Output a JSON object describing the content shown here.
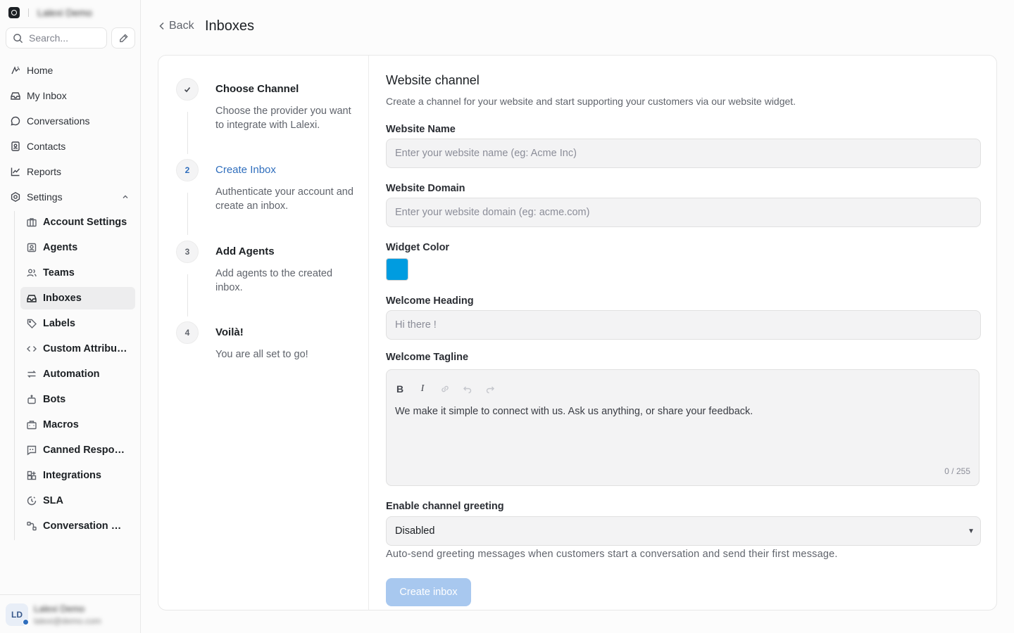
{
  "sidebar": {
    "account_name": "Lalexi Demo",
    "search_placeholder": "Search...",
    "nav": [
      {
        "label": "Home",
        "icon": "home-icon"
      },
      {
        "label": "My Inbox",
        "icon": "inbox-icon"
      },
      {
        "label": "Conversations",
        "icon": "chat-bubble-icon"
      },
      {
        "label": "Contacts",
        "icon": "contact-book-icon"
      },
      {
        "label": "Reports",
        "icon": "line-chart-icon"
      },
      {
        "label": "Settings",
        "icon": "gear-icon"
      }
    ],
    "settings_items": [
      {
        "label": "Account Settings",
        "icon": "briefcase-icon"
      },
      {
        "label": "Agents",
        "icon": "contact-icon"
      },
      {
        "label": "Teams",
        "icon": "users-icon"
      },
      {
        "label": "Inboxes",
        "icon": "inbox-icon",
        "active": true
      },
      {
        "label": "Labels",
        "icon": "tag-icon"
      },
      {
        "label": "Custom Attributes",
        "icon": "code-icon"
      },
      {
        "label": "Automation",
        "icon": "arrows-exchange-icon"
      },
      {
        "label": "Bots",
        "icon": "bot-icon"
      },
      {
        "label": "Macros",
        "icon": "toolbox-icon"
      },
      {
        "label": "Canned Responses",
        "icon": "quote-icon"
      },
      {
        "label": "Integrations",
        "icon": "grid-plus-icon"
      },
      {
        "label": "SLA",
        "icon": "clock-icon"
      },
      {
        "label": "Conversation Workflows",
        "icon": "workflow-icon"
      }
    ],
    "user": {
      "initials": "LD",
      "name": "Lalexi Demo",
      "email": "lalexi@demo.com"
    }
  },
  "header": {
    "back_label": "Back",
    "title": "Inboxes"
  },
  "steps": [
    {
      "marker": "✓",
      "title": "Choose Channel",
      "desc": "Choose the provider you want to integrate with Lalexi."
    },
    {
      "marker": "2",
      "title": "Create Inbox",
      "desc": "Authenticate your account and create an inbox.",
      "active": true
    },
    {
      "marker": "3",
      "title": "Add Agents",
      "desc": "Add agents to the created inbox."
    },
    {
      "marker": "4",
      "title": "Voilà!",
      "desc": "You are all set to go!"
    }
  ],
  "form": {
    "title": "Website channel",
    "subtitle": "Create a channel for your website and start supporting your customers via our website widget.",
    "website_name_label": "Website Name",
    "website_name_placeholder": "Enter your website name (eg: Acme Inc)",
    "website_domain_label": "Website Domain",
    "website_domain_placeholder": "Enter your website domain (eg: acme.com)",
    "widget_color_label": "Widget Color",
    "widget_color": "#009CE0",
    "welcome_heading_label": "Welcome Heading",
    "welcome_heading_placeholder": "Hi there !",
    "welcome_tagline_label": "Welcome Tagline",
    "welcome_tagline_text": "We make it simple to connect with us. Ask us anything, or share your feedback.",
    "tagline_counter": "0 / 255",
    "greeting_label": "Enable channel greeting",
    "greeting_value": "Disabled",
    "greeting_help": "Auto-send greeting messages when customers start a conversation and send their first message.",
    "submit_label": "Create inbox"
  },
  "colors": {
    "accent": "#2F6EBD",
    "button_disabled": "#A8C8EF"
  }
}
